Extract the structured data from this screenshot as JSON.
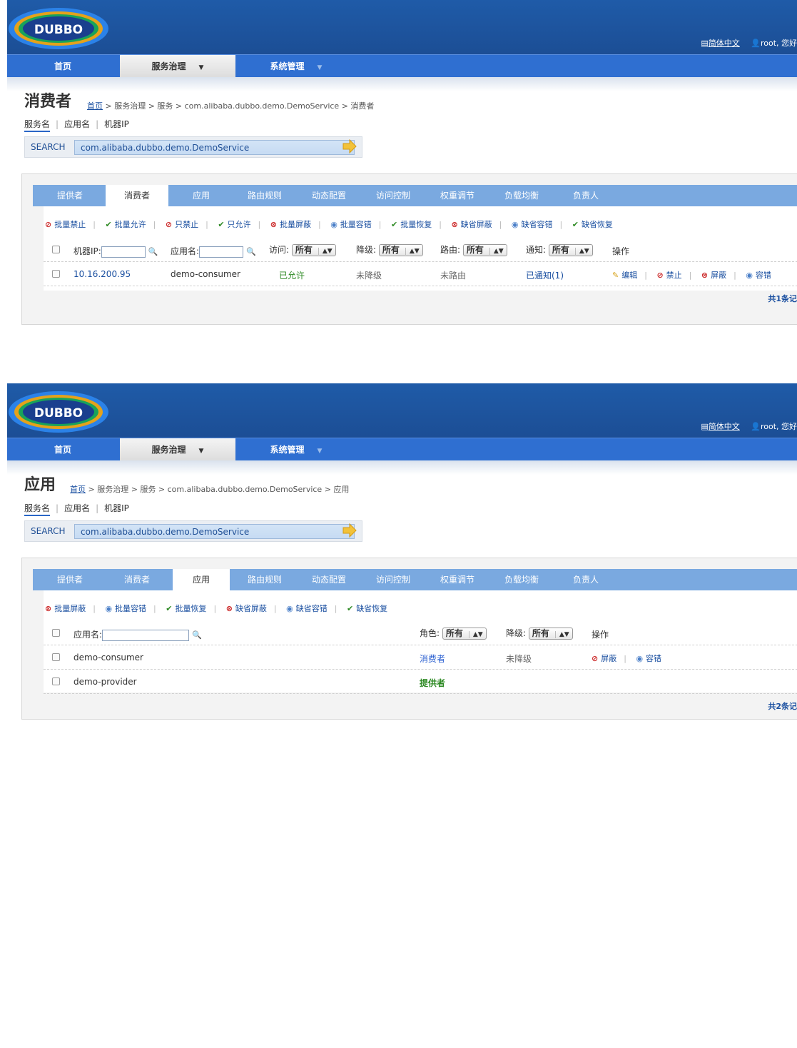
{
  "colors": {
    "header": "#1f5ba8",
    "nav": "#2f6fd1",
    "tab_bar": "#7aa9e0",
    "accent": "#1a4fa0"
  },
  "header": {
    "logo_text": "DUBBO",
    "language": "简体中文",
    "user": "root, 您好"
  },
  "nav": {
    "home": "首页",
    "governance": "服务治理",
    "system": "系统管理"
  },
  "search": {
    "label": "SEARCH",
    "value": "com.alibaba.dubbo.demo.DemoService"
  },
  "search_tabs": [
    "服务名",
    "应用名",
    "机器IP"
  ],
  "panel_tabs": [
    "提供者",
    "消费者",
    "应用",
    "路由规则",
    "动态配置",
    "访问控制",
    "权重调节",
    "负载均衡",
    "负责人"
  ],
  "consumer": {
    "title": "消费者",
    "breadcrumb": {
      "home": "首页",
      "rest": " > 服务治理 > 服务 > com.alibaba.dubbo.demo.DemoService > 消费者"
    },
    "actions": [
      "批量禁止",
      "批量允许",
      "只禁止",
      "只允许",
      "批量屏蔽",
      "批量容错",
      "批量恢复",
      "缺省屏蔽",
      "缺省容错",
      "缺省恢复"
    ],
    "header": {
      "ip": "机器IP:",
      "app": "应用名:",
      "access": "访问:",
      "degrade": "降级:",
      "route": "路由:",
      "notify": "通知:",
      "ops": "操作",
      "all": "所有"
    },
    "rows": [
      {
        "ip": "10.16.200.95",
        "app": "demo-consumer",
        "access": "已允许",
        "degrade": "未降级",
        "route": "未路由",
        "notify": "已通知(1)"
      }
    ],
    "row_ops": [
      "编辑",
      "禁止",
      "屏蔽",
      "容错"
    ],
    "total": "共1条记"
  },
  "application": {
    "title": "应用",
    "breadcrumb": {
      "home": "首页",
      "rest": " > 服务治理 > 服务 > com.alibaba.dubbo.demo.DemoService > 应用"
    },
    "actions": [
      "批量屏蔽",
      "批量容错",
      "批量恢复",
      "缺省屏蔽",
      "缺省容错",
      "缺省恢复"
    ],
    "header": {
      "app": "应用名:",
      "role": "角色:",
      "degrade": "降级:",
      "ops": "操作",
      "all": "所有"
    },
    "rows": [
      {
        "app": "demo-consumer",
        "role": "消费者",
        "degrade": "未降级"
      },
      {
        "app": "demo-provider",
        "role": "提供者",
        "degrade": ""
      }
    ],
    "row_ops": [
      "屏蔽",
      "容错"
    ],
    "total": "共2条记"
  }
}
